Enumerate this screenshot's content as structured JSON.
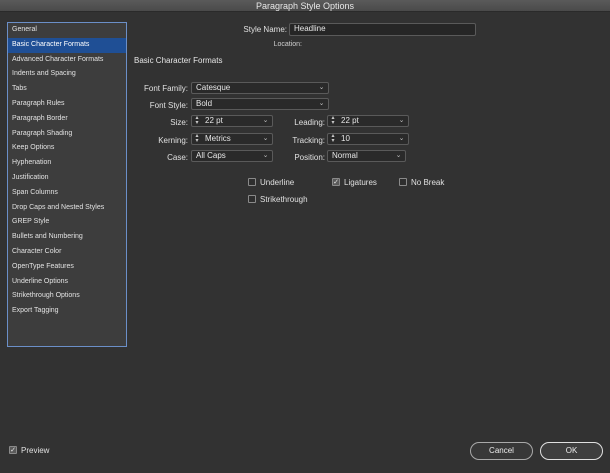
{
  "window": {
    "title": "Paragraph Style Options"
  },
  "sidebar": {
    "items": [
      {
        "label": "General"
      },
      {
        "label": "Basic Character Formats"
      },
      {
        "label": "Advanced Character Formats"
      },
      {
        "label": "Indents and Spacing"
      },
      {
        "label": "Tabs"
      },
      {
        "label": "Paragraph Rules"
      },
      {
        "label": "Paragraph Border"
      },
      {
        "label": "Paragraph Shading"
      },
      {
        "label": "Keep Options"
      },
      {
        "label": "Hyphenation"
      },
      {
        "label": "Justification"
      },
      {
        "label": "Span Columns"
      },
      {
        "label": "Drop Caps and Nested Styles"
      },
      {
        "label": "GREP Style"
      },
      {
        "label": "Bullets and Numbering"
      },
      {
        "label": "Character Color"
      },
      {
        "label": "OpenType Features"
      },
      {
        "label": "Underline Options"
      },
      {
        "label": "Strikethrough Options"
      },
      {
        "label": "Export Tagging"
      }
    ],
    "selected_index": 1
  },
  "header": {
    "style_name_label": "Style Name:",
    "style_name_value": "Headline",
    "location_label": "Location:"
  },
  "section": {
    "title": "Basic Character Formats"
  },
  "form": {
    "font_family": {
      "label": "Font Family:",
      "value": "Catesque"
    },
    "font_style": {
      "label": "Font Style:",
      "value": "Bold"
    },
    "size": {
      "label": "Size:",
      "value": "22 pt"
    },
    "leading": {
      "label": "Leading:",
      "value": "22 pt"
    },
    "kerning": {
      "label": "Kerning:",
      "value": "Metrics"
    },
    "tracking": {
      "label": "Tracking:",
      "value": "10"
    },
    "case": {
      "label": "Case:",
      "value": "All Caps"
    },
    "position": {
      "label": "Position:",
      "value": "Normal"
    }
  },
  "options": {
    "underline": {
      "label": "Underline",
      "checked": false
    },
    "ligatures": {
      "label": "Ligatures",
      "checked": true
    },
    "no_break": {
      "label": "No Break",
      "checked": false
    },
    "strikethrough": {
      "label": "Strikethrough",
      "checked": false
    }
  },
  "footer": {
    "preview": {
      "label": "Preview",
      "checked": true
    },
    "cancel_label": "Cancel",
    "ok_label": "OK"
  },
  "icons": {
    "dropdown": "chevron-down-icon",
    "stepper": "stepper-icon",
    "check": "checkmark-icon"
  }
}
